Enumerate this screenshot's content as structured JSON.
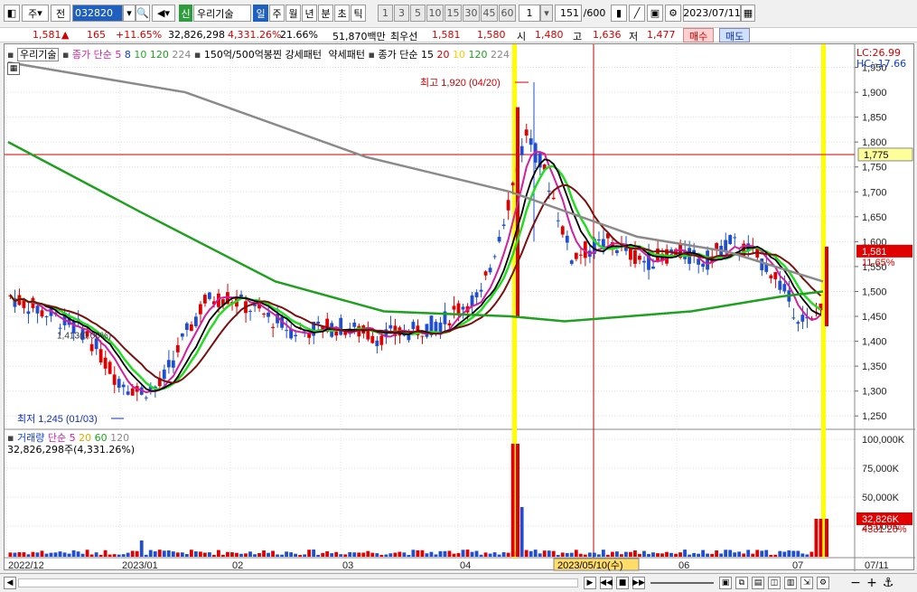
{
  "toolbar": {
    "period_main": "주",
    "prev_label": "전",
    "code": "032820",
    "badge": "신",
    "stock_name": "우리기술",
    "periods": [
      "일",
      "주",
      "월",
      "년",
      "분",
      "초",
      "틱"
    ],
    "intervals": [
      "1",
      "3",
      "5",
      "10",
      "15",
      "30",
      "45",
      "60"
    ],
    "count_value": "1",
    "page_count": "151",
    "page_total": "/600",
    "date": "2023/07/11"
  },
  "quote": {
    "price": "1,581",
    "change_arrow": "▲",
    "change": "165",
    "change_pct": "+11.65%",
    "volume": "32,826,298",
    "volume_ratio": "4,331.26%",
    "turnover": "21.66%",
    "amount": "51,870백만",
    "best_label": "최우선",
    "best_ask": "1,581",
    "best_bid": "1,580",
    "open_label": "시",
    "open": "1,480",
    "high_label": "고",
    "high": "1,636",
    "low_label": "저",
    "low": "1,477",
    "buy_label": "매수",
    "sell_label": "매도"
  },
  "legend_top": {
    "name": "우리기술",
    "ma_label": "종가 단순",
    "ma": [
      "5",
      "8",
      "10",
      "120",
      "224"
    ],
    "pattern1": "150억/500억봉찐",
    "pattern2": "강세패턴",
    "pattern3": "약세패턴",
    "ma2_label": "종가 단순 15",
    "ma2": [
      "20",
      "10",
      "120",
      "224"
    ],
    "lc": "LC:26.99",
    "hc": "HC:-17.66"
  },
  "legend_vol": {
    "name": "거래량",
    "ma_label": "단순",
    "ma": [
      "5",
      "20",
      "60",
      "120"
    ],
    "value": "32,826,298주(4,331.26%)"
  },
  "annotations": {
    "high": "최고 1,920 (04/20)",
    "low": "최저 1,245 (01/03)",
    "mid": "1,413(0.00%)",
    "crosshair_price": "1,775",
    "price_tag": "1,581",
    "price_tag_pct": "11.65%",
    "vol_tag": "32,826K",
    "vol_tag_pct": "4331.26%",
    "crosshair_date": "2023/05/10(수)"
  },
  "colors": {
    "up": "#e00000",
    "down": "#1f4fd0",
    "ma5": "#d020a0",
    "ma8": "#000000",
    "ma10": "#22dd22",
    "ma120": "#20a020",
    "ma224": "#8a8a8a",
    "ma_brown": "#7a1010",
    "highlight": "#ffff00"
  },
  "chart_data": {
    "type": "candlestick",
    "y_ticks": [
      "1,950",
      "1,900",
      "1,850",
      "1,800",
      "1,750",
      "1,700",
      "1,650",
      "1,600",
      "1,550",
      "1,500",
      "1,450",
      "1,400",
      "1,350",
      "1,300",
      "1,250"
    ],
    "vol_ticks": [
      "100,000K",
      "75,000K",
      "50,000K",
      "25,000K"
    ],
    "x_labels": [
      "2022/12",
      "2023/01",
      "02",
      "03",
      "04",
      "06",
      "07",
      "07/11"
    ],
    "ylim": [
      1225,
      1960
    ]
  }
}
